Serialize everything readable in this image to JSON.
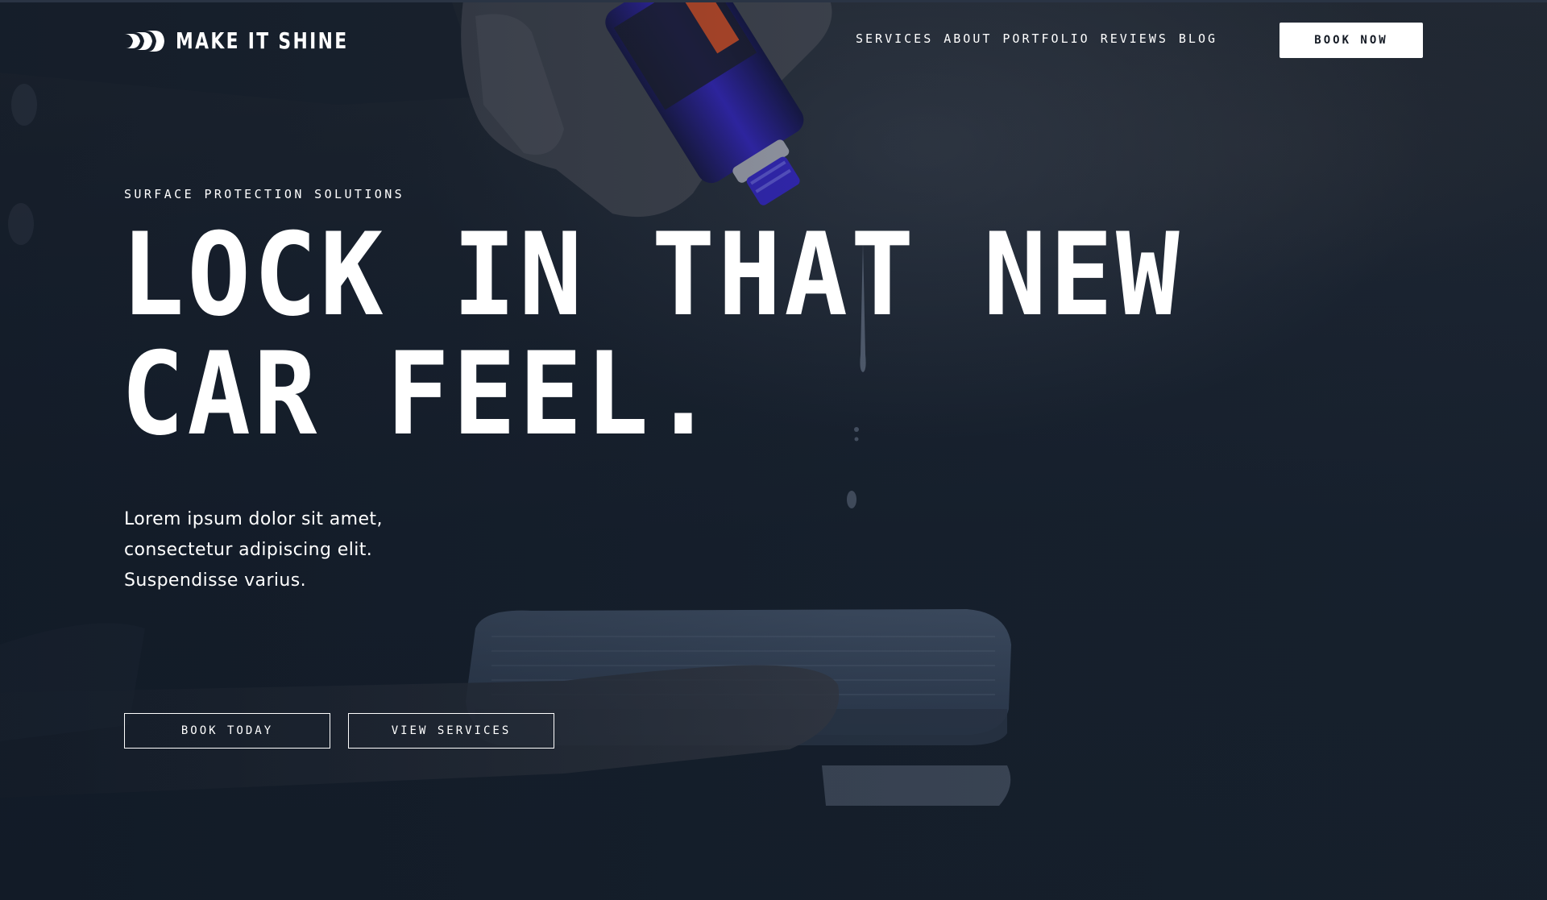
{
  "brand": {
    "name": "MAKE IT SHINE",
    "logo_icon": "chevron-stripes-logo"
  },
  "nav": {
    "items": [
      {
        "label": "SERVICES"
      },
      {
        "label": "ABOUT"
      },
      {
        "label": "PORTFOLIO"
      },
      {
        "label": "REVIEWS"
      },
      {
        "label": "BLOG"
      }
    ],
    "cta_label": "BOOK NOW"
  },
  "hero": {
    "eyebrow": "SURFACE PROTECTION SOLUTIONS",
    "headline_lines": [
      "LOCK IN THAT NEW",
      "CAR FEEL."
    ],
    "lede_lines": [
      "Lorem ipsum dolor sit amet,",
      "consectetur adipiscing elit.",
      "Suspendisse varius."
    ],
    "buttons": {
      "primary": "BOOK TODAY",
      "secondary": "VIEW SERVICES"
    }
  },
  "colors": {
    "background": "#18222f",
    "text": "#ffffff",
    "cta_fill": "#ffffff",
    "cta_text": "#141a24",
    "bottle_accent": "#3b2bd6",
    "label_accent": "#e0552b"
  }
}
